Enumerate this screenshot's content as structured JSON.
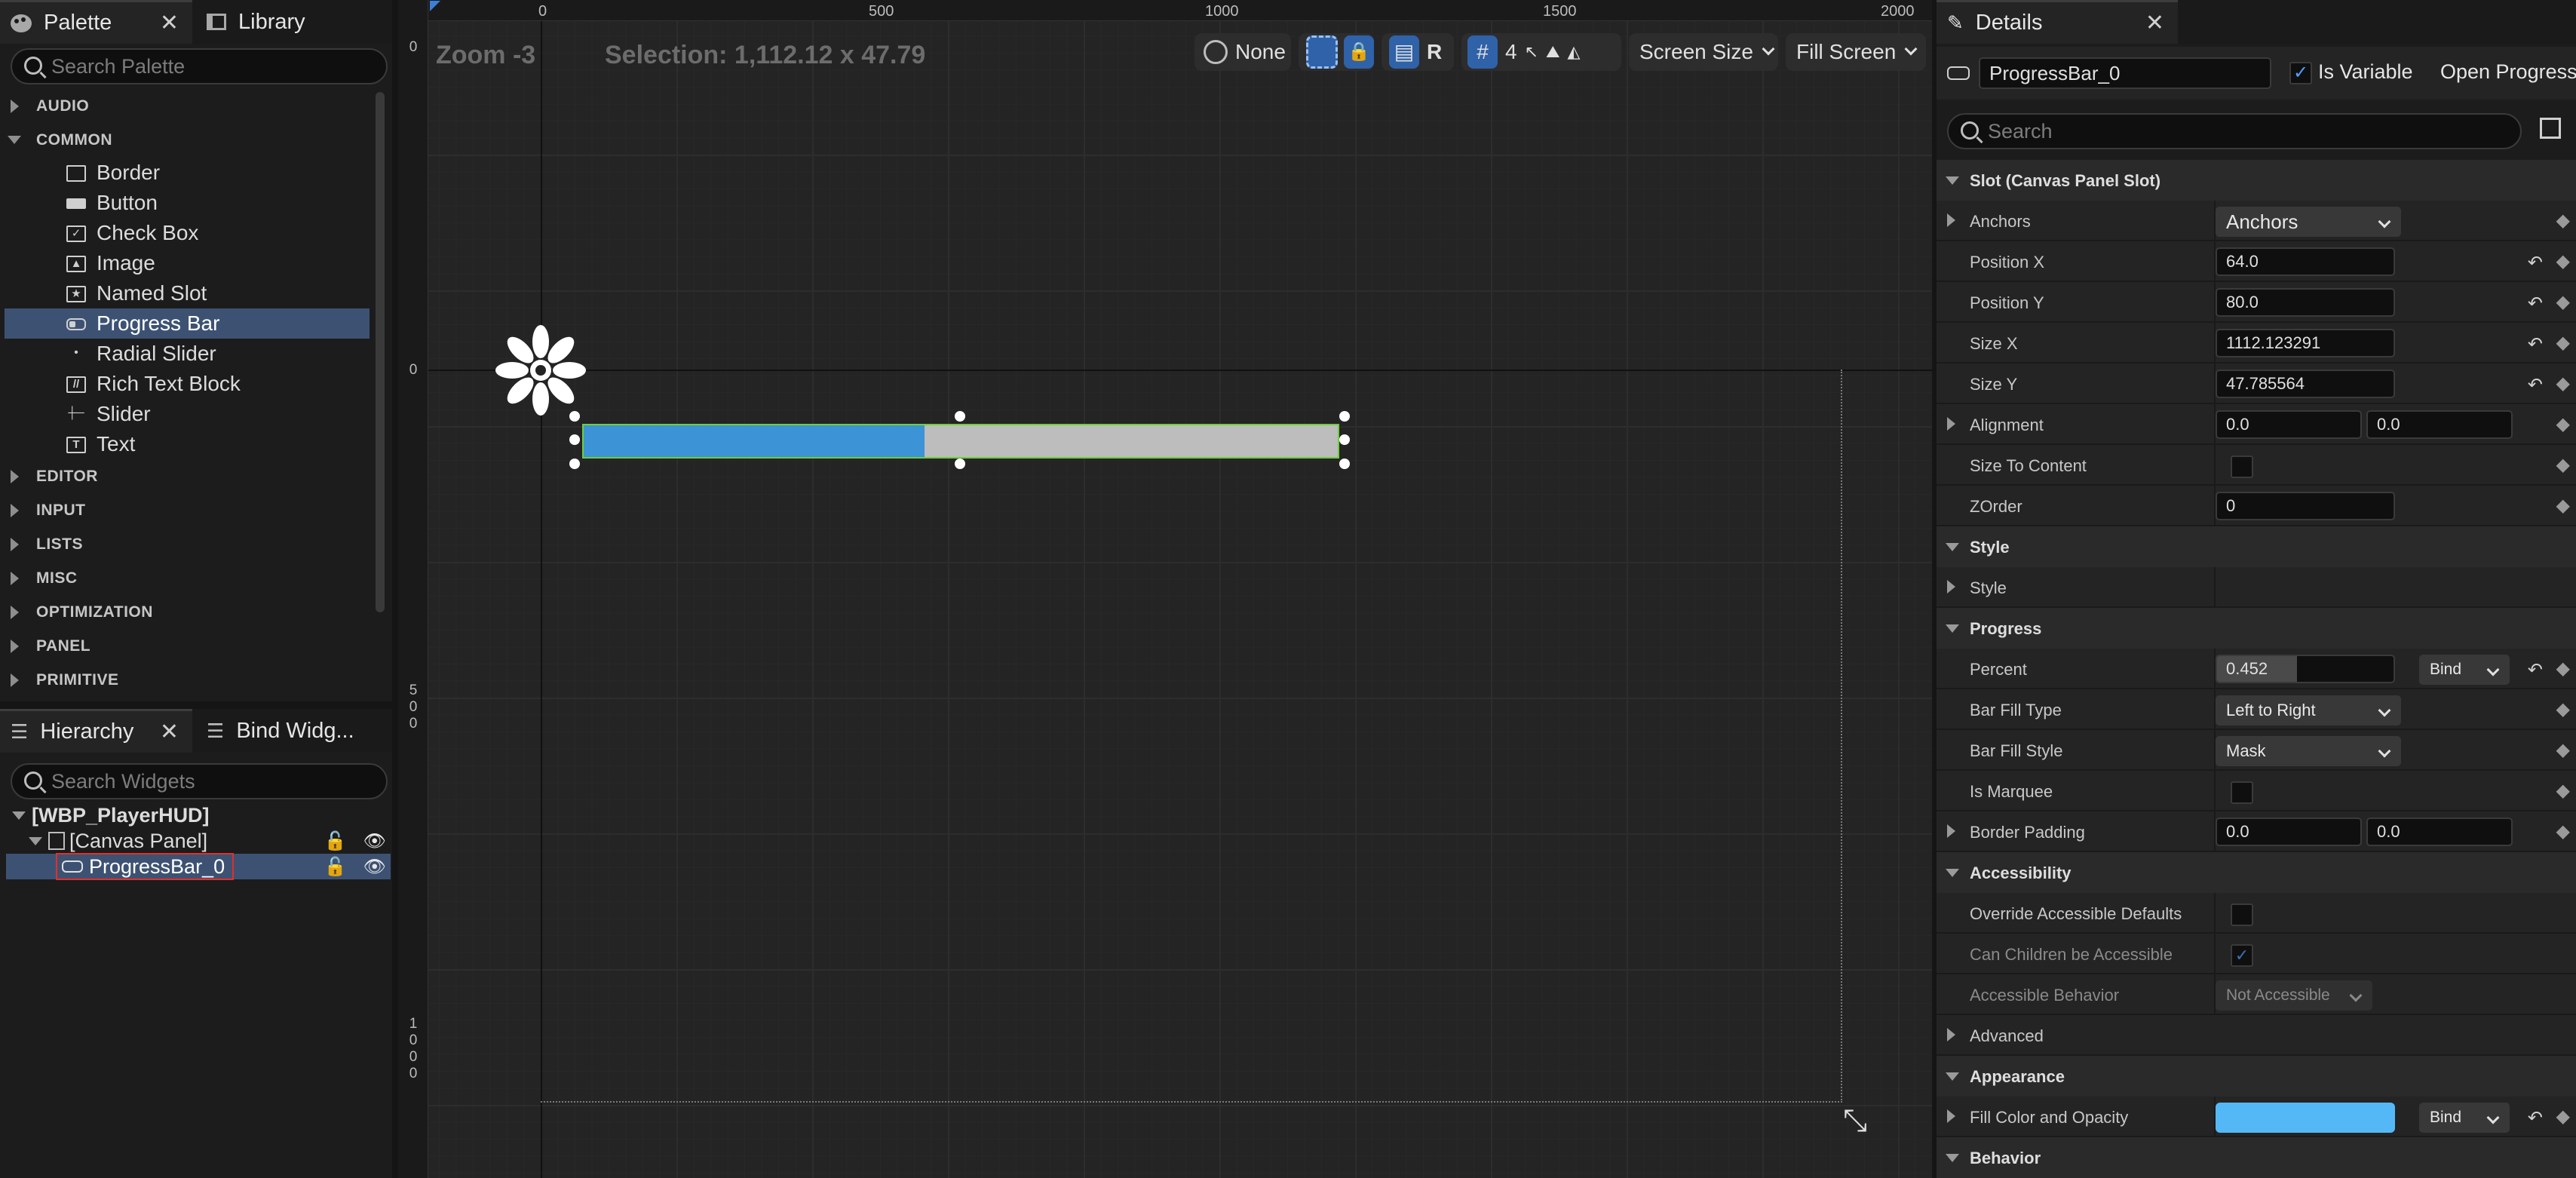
{
  "palette": {
    "tab_label": "Palette",
    "library_tab_label": "Library",
    "search_placeholder": "Search Palette",
    "categories_top": [
      "AUDIO",
      "COMMON"
    ],
    "common_items": [
      {
        "label": "Border",
        "icon": "border-icon"
      },
      {
        "label": "Button",
        "icon": "button-icon"
      },
      {
        "label": "Check Box",
        "icon": "checkbox-icon"
      },
      {
        "label": "Image",
        "icon": "image-icon"
      },
      {
        "label": "Named Slot",
        "icon": "named-slot-icon"
      },
      {
        "label": "Progress Bar",
        "icon": "progress-bar-icon",
        "selected": true
      },
      {
        "label": "Radial Slider",
        "icon": "radial-slider-icon"
      },
      {
        "label": "Rich Text Block",
        "icon": "rich-text-icon"
      },
      {
        "label": "Slider",
        "icon": "slider-icon"
      },
      {
        "label": "Text",
        "icon": "text-icon"
      }
    ],
    "categories_bottom": [
      "EDITOR",
      "INPUT",
      "LISTS",
      "MISC",
      "OPTIMIZATION",
      "PANEL",
      "PRIMITIVE"
    ]
  },
  "hierarchy": {
    "tab_label": "Hierarchy",
    "bind_tab_label": "Bind Widg...",
    "search_placeholder": "Search Widgets",
    "root": "[WBP_PlayerHUD]",
    "canvas": "[Canvas Panel]",
    "selected_item": "ProgressBar_0"
  },
  "viewport": {
    "zoom_label": "Zoom -3",
    "selection_label": "Selection: 1,112.12 x 47.79",
    "ruler_top": [
      "0",
      "500",
      "1000",
      "1500",
      "2000"
    ],
    "ruler_left": [
      "0",
      "0",
      "500",
      "1000"
    ],
    "toolbar": {
      "localization": "None",
      "r_label": "R",
      "grid_size": "4",
      "screen_size": "Screen Size",
      "fill_screen": "Fill Screen"
    },
    "progress_percent": 0.452,
    "colors": {
      "fill": "#3c93d6",
      "background": "#bdbdbd",
      "outline": "#6fcf3a"
    }
  },
  "details": {
    "tab_label": "Details",
    "widget_name": "ProgressBar_0",
    "is_variable_label": "Is Variable",
    "open_label": "Open Progress",
    "search_placeholder": "Search",
    "sections": {
      "slot": "Slot (Canvas Panel Slot)",
      "style": "Style",
      "progress": "Progress",
      "accessibility": "Accessibility",
      "appearance": "Appearance",
      "behavior": "Behavior"
    },
    "props": {
      "anchors": "Anchors",
      "anchors_value": "Anchors",
      "position_x": "Position X",
      "position_x_value": "64.0",
      "position_y": "Position Y",
      "position_y_value": "80.0",
      "size_x": "Size X",
      "size_x_value": "1112.123291",
      "size_y": "Size Y",
      "size_y_value": "47.785564",
      "alignment": "Alignment",
      "alignment_x": "0.0",
      "alignment_y": "0.0",
      "size_to_content": "Size To Content",
      "zorder": "ZOrder",
      "zorder_value": "0",
      "style": "Style",
      "percent": "Percent",
      "percent_value": "0.452",
      "bind": "Bind",
      "bar_fill_type": "Bar Fill Type",
      "bar_fill_type_value": "Left to Right",
      "bar_fill_style": "Bar Fill Style",
      "bar_fill_style_value": "Mask",
      "is_marquee": "Is Marquee",
      "border_padding": "Border Padding",
      "border_padding_x": "0.0",
      "border_padding_y": "0.0",
      "override_accessible": "Override Accessible Defaults",
      "can_children": "Can Children be Accessible",
      "accessible_behavior": "Accessible Behavior",
      "accessible_behavior_value": "Not Accessible",
      "advanced": "Advanced",
      "fill_color": "Fill Color and Opacity",
      "fill_color_hex": "#55b8f6"
    }
  }
}
